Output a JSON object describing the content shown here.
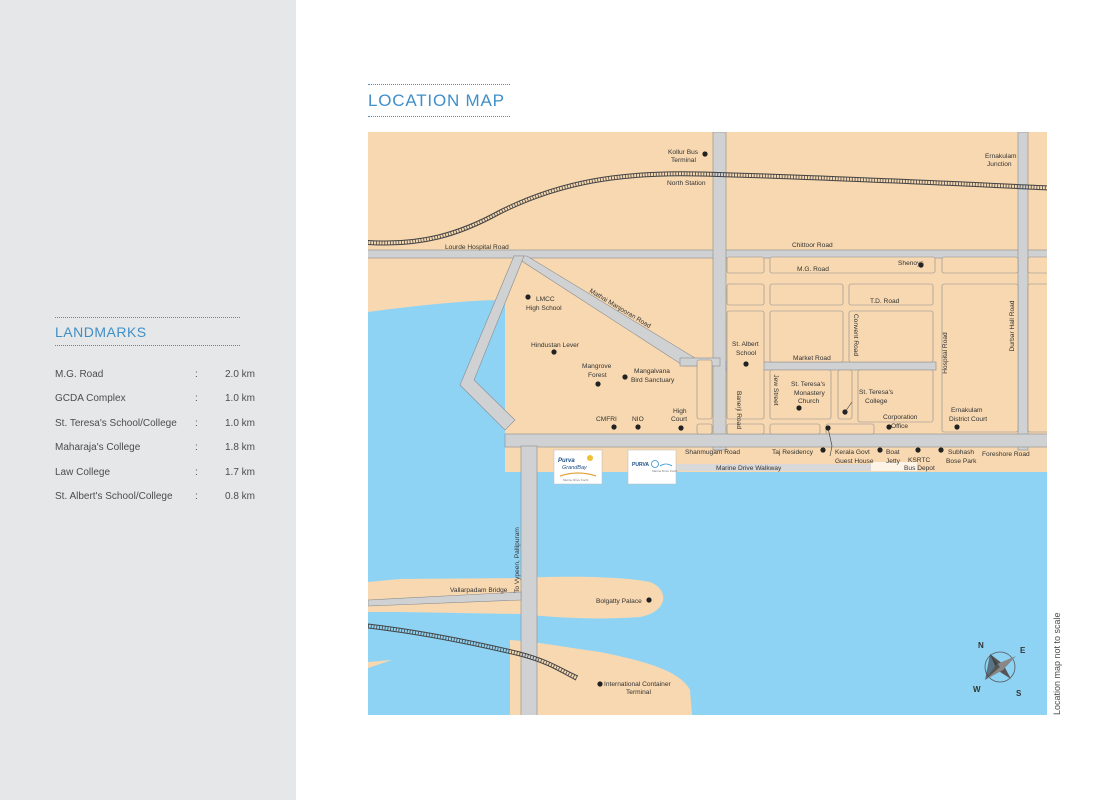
{
  "sidebar": {
    "title": "LANDMARKS",
    "items": [
      {
        "name": "M.G. Road",
        "distance": "2.0 km"
      },
      {
        "name": "GCDA Complex",
        "distance": "1.0 km"
      },
      {
        "name": "St. Teresa's School/College",
        "distance": "1.0 km"
      },
      {
        "name": "Maharaja's College",
        "distance": "1.8 km"
      },
      {
        "name": "Law College",
        "distance": "1.7 km"
      },
      {
        "name": "St. Albert's School/College",
        "distance": "0.8 km"
      }
    ]
  },
  "map": {
    "title": "LOCATION MAP",
    "scale_note": "Location map not to scale",
    "colors": {
      "land": "#f7d8b0",
      "water": "#8fd3f4",
      "road": "#cfd1d3",
      "railway": "#333333"
    },
    "roads": {
      "lourde": "Lourde Hospital Road",
      "chittoor": "Chittoor Road",
      "mg": "M.G. Road",
      "td": "T.D. Road",
      "market": "Market Road",
      "mathai": "Mathai Manjooran Road",
      "banerji": "Banerji Road",
      "jew": "Jew Street",
      "convent": "Convent Road",
      "hospital": "Hospital Road",
      "durbar": "Durbar Hall Road",
      "shanmugam": "Shanmugam Road",
      "foreshore": "Foreshore Road",
      "walkway": "Marine Drive Walkway",
      "vypeen": "To Vypeen, Pallipuram",
      "vallarpadam": "Vallarpadam Bridge"
    },
    "places": {
      "kollur_1": "Kollur Bus",
      "kollur_2": "Terminal",
      "north_station": "North Station",
      "ernakulam_jn_1": "Ernakulam",
      "ernakulam_jn_2": "Junction",
      "shenoys": "Shenoys",
      "lmcc_1": "LMCC",
      "lmcc_2": "High School",
      "hindustan": "Hindustan Lever",
      "mangrove_1": "Mangrove",
      "mangrove_2": "Forest",
      "mangalvana_1": "Mangalvana",
      "mangalvana_2": "Bird Sanctuary",
      "cmfri": "CMFRI",
      "nio": "NIO",
      "high_court_1": "High",
      "high_court_2": "Court",
      "st_albert_1": "St. Albert",
      "st_albert_2": "School",
      "monastery_1": "St. Teresa's",
      "monastery_2": "Monastery",
      "monastery_3": "Church",
      "teresa_college_1": "St. Teresa's",
      "teresa_college_2": "College",
      "corporation_1": "Corporation",
      "corporation_2": "Office",
      "district_court_1": "Ernakulam",
      "district_court_2": "District Court",
      "taj": "Taj Residency",
      "kerala_govt_1": "Kerala Govt",
      "kerala_govt_2": "Guest House",
      "boat_jetty_1": "Boat",
      "boat_jetty_2": "Jetty",
      "ksrtc_1": "KSRTC",
      "ksrtc_2": "Bus Depot",
      "subhash_1": "Subhash",
      "subhash_2": "Bose Park",
      "bolgatty": "Bolgatty Palace",
      "container_1": "International Container",
      "container_2": "Terminal"
    },
    "compass": {
      "n": "N",
      "e": "E",
      "s": "S",
      "w": "W"
    }
  }
}
